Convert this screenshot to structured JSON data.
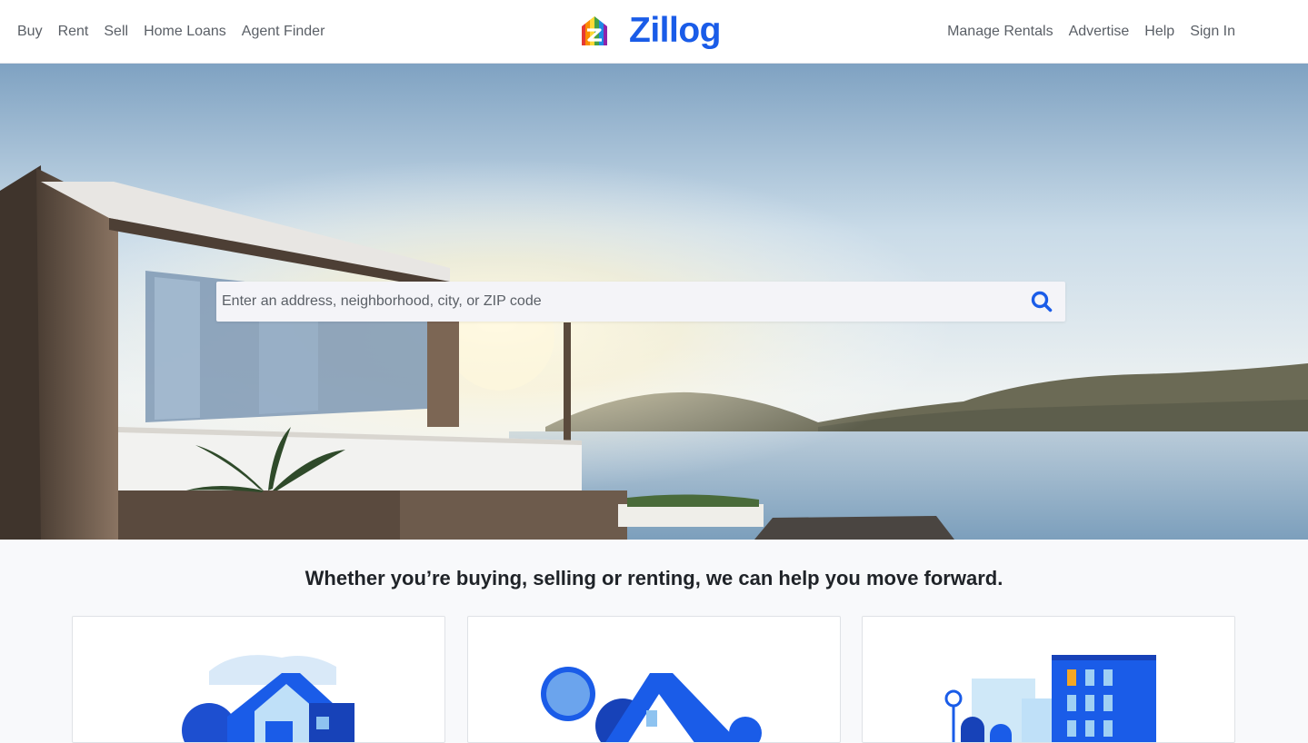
{
  "nav": {
    "left_links": [
      "Buy",
      "Rent",
      "Sell",
      "Home Loans",
      "Agent Finder"
    ],
    "right_links": [
      "Manage Rentals",
      "Advertise",
      "Help",
      "Sign In"
    ],
    "brand_name": "Zillog",
    "logo_icon": "rainbow-house-logo-icon"
  },
  "hero": {
    "background": "hillside-villa-seaside-photo",
    "search": {
      "placeholder": "Enter an address, neighborhood, city, or ZIP code",
      "value": "",
      "icon": "search-icon"
    }
  },
  "main": {
    "tagline": "Whether you’re buying, selling or renting, we can help you move forward.",
    "cards": [
      {
        "illustration": "buy-home-illustration"
      },
      {
        "illustration": "sell-home-illustration"
      },
      {
        "illustration": "rent-building-illustration"
      }
    ]
  },
  "colors": {
    "brand": "#1a5ce8",
    "nav_text": "#5a5f66",
    "page_bg": "#f8f9fb"
  }
}
